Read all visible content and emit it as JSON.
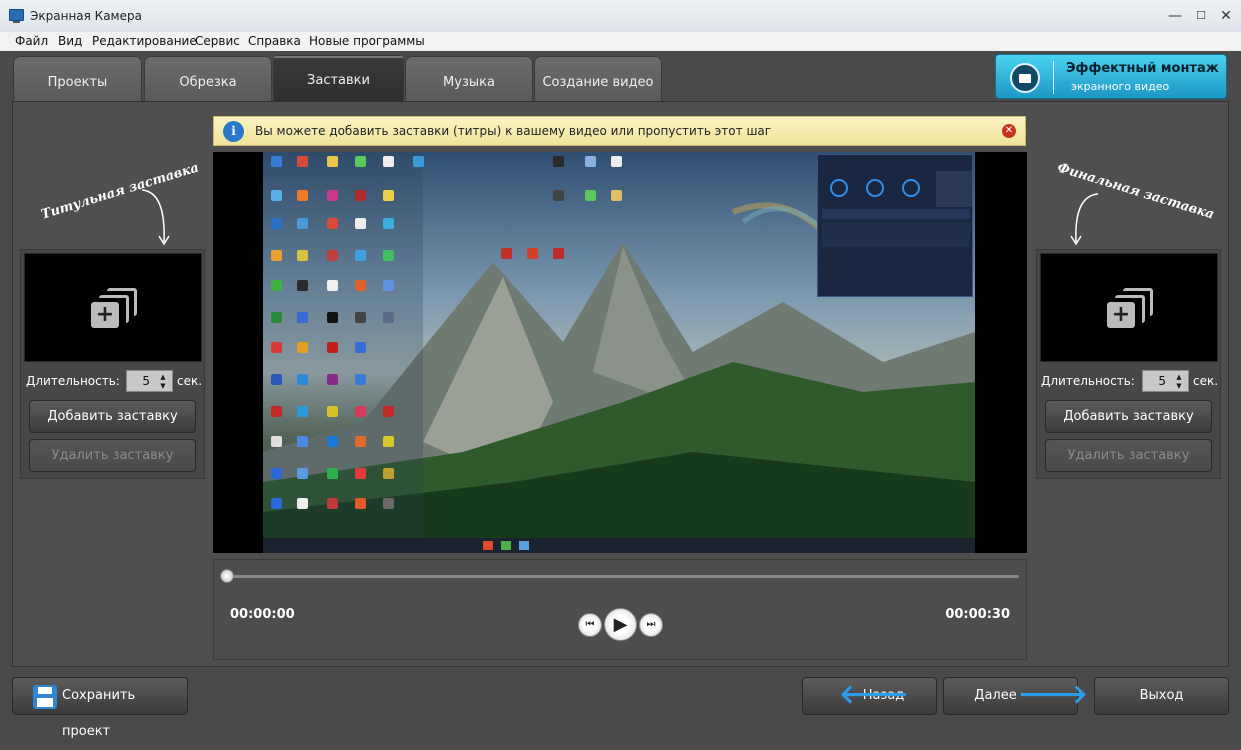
{
  "window": {
    "title": "Экранная Камера",
    "min": "—",
    "max": "☐",
    "close": "✕"
  },
  "menu": [
    "Файл",
    "Вид",
    "Редактирование",
    "Сервис",
    "Справка",
    "Новые программы"
  ],
  "tabs": [
    "Проекты",
    "Обрезка",
    "Заставки",
    "Музыка",
    "Создание видео"
  ],
  "promo": {
    "line1": "Эффектный монтаж",
    "line2": "экранного видео"
  },
  "info": {
    "icon": "i",
    "text": "Вы можете добавить заставки (титры) к вашему видео или пропустить этот шаг",
    "close": "✕"
  },
  "left": {
    "title": "Титульная заставка",
    "duration_label": "Длительность:",
    "duration": "5",
    "unit": "сек.",
    "add": "Добавить заставку",
    "remove": "Удалить заставку"
  },
  "right": {
    "title": "Финальная заставка",
    "duration_label": "Длительность:",
    "duration": "5",
    "unit": "сек.",
    "add": "Добавить заставку",
    "remove": "Удалить заставку"
  },
  "player": {
    "current": "00:00:00",
    "total": "00:00:30",
    "progress": 0
  },
  "bottom": {
    "save": "Сохранить проект",
    "back": "Назад",
    "next": "Далее",
    "exit": "Выход"
  }
}
